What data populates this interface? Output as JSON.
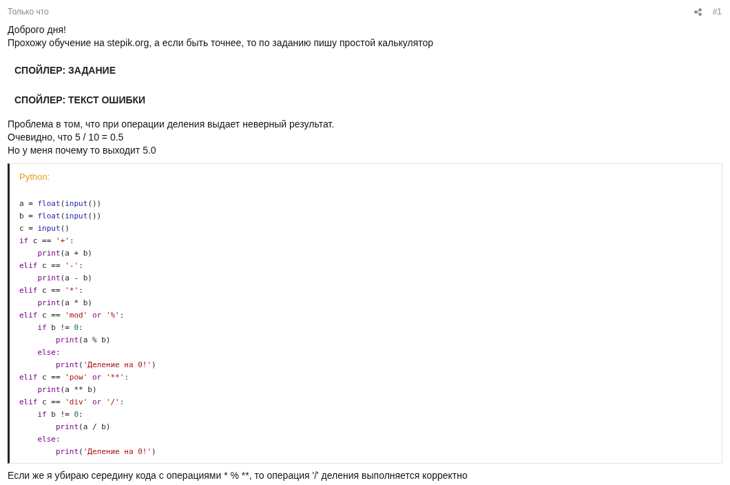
{
  "post": {
    "time": "Только что",
    "number": "#1"
  },
  "paragraphs_before": [
    "Доброго дня!",
    "Прохожу обучение на stepik.org, а если быть точнее, то по заданию пишу простой калькулятор"
  ],
  "spoilers": [
    "СПОЙЛЕР: ЗАДАНИЕ",
    "СПОЙЛЕР: ТЕКСТ ОШИБКИ"
  ],
  "paragraphs_middle": [
    "Проблема в том, что при операции деления выдает неверный результат.",
    "Очевидно, что 5 / 10 = 0.5",
    "Но у меня почему то выходит 5.0"
  ],
  "code_block": {
    "language": "Python:",
    "lines": [
      {
        "tokens": [
          {
            "kind": "plain",
            "text": "a = "
          },
          {
            "kind": "builtin",
            "text": "float"
          },
          {
            "kind": "plain",
            "text": "("
          },
          {
            "kind": "builtin",
            "text": "input"
          },
          {
            "kind": "plain",
            "text": "())"
          }
        ]
      },
      {
        "tokens": [
          {
            "kind": "plain",
            "text": "b = "
          },
          {
            "kind": "builtin",
            "text": "float"
          },
          {
            "kind": "plain",
            "text": "("
          },
          {
            "kind": "builtin",
            "text": "input"
          },
          {
            "kind": "plain",
            "text": "())"
          }
        ]
      },
      {
        "tokens": [
          {
            "kind": "plain",
            "text": "c = "
          },
          {
            "kind": "builtin",
            "text": "input"
          },
          {
            "kind": "plain",
            "text": "()"
          }
        ]
      },
      {
        "tokens": [
          {
            "kind": "keyword",
            "text": "if"
          },
          {
            "kind": "plain",
            "text": " c == "
          },
          {
            "kind": "string",
            "text": "'+'"
          },
          {
            "kind": "plain",
            "text": ":"
          }
        ],
        "children": [
          {
            "tokens": [
              {
                "kind": "keyword",
                "text": "print"
              },
              {
                "kind": "plain",
                "text": "(a + b)"
              }
            ]
          }
        ]
      },
      {
        "tokens": [
          {
            "kind": "keyword",
            "text": "elif"
          },
          {
            "kind": "plain",
            "text": " c == "
          },
          {
            "kind": "string",
            "text": "'-'"
          },
          {
            "kind": "plain",
            "text": ":"
          }
        ],
        "children": [
          {
            "tokens": [
              {
                "kind": "keyword",
                "text": "print"
              },
              {
                "kind": "plain",
                "text": "(a - b)"
              }
            ]
          }
        ]
      },
      {
        "tokens": [
          {
            "kind": "keyword",
            "text": "elif"
          },
          {
            "kind": "plain",
            "text": " c == "
          },
          {
            "kind": "string",
            "text": "'*'"
          },
          {
            "kind": "plain",
            "text": ":"
          }
        ],
        "children": [
          {
            "tokens": [
              {
                "kind": "keyword",
                "text": "print"
              },
              {
                "kind": "plain",
                "text": "(a * b)"
              }
            ]
          }
        ]
      },
      {
        "tokens": [
          {
            "kind": "keyword",
            "text": "elif"
          },
          {
            "kind": "plain",
            "text": " c == "
          },
          {
            "kind": "string",
            "text": "'mod'"
          },
          {
            "kind": "keyword",
            "text": " or "
          },
          {
            "kind": "string",
            "text": "'%'"
          },
          {
            "kind": "plain",
            "text": ":"
          }
        ],
        "children": [
          {
            "tokens": [
              {
                "kind": "keyword",
                "text": "if"
              },
              {
                "kind": "plain",
                "text": " b != "
              },
              {
                "kind": "number",
                "text": "0"
              },
              {
                "kind": "plain",
                "text": ":"
              }
            ],
            "children": [
              {
                "tokens": [
                  {
                    "kind": "keyword",
                    "text": "print"
                  },
                  {
                    "kind": "plain",
                    "text": "(a % b)"
                  }
                ]
              }
            ]
          },
          {
            "tokens": [
              {
                "kind": "keyword",
                "text": "else"
              },
              {
                "kind": "plain",
                "text": ":"
              }
            ],
            "children": [
              {
                "tokens": [
                  {
                    "kind": "keyword",
                    "text": "print"
                  },
                  {
                    "kind": "plain",
                    "text": "("
                  },
                  {
                    "kind": "string",
                    "text": "'Деление на 0!'"
                  },
                  {
                    "kind": "plain",
                    "text": ")"
                  }
                ]
              }
            ]
          }
        ]
      },
      {
        "tokens": [
          {
            "kind": "keyword",
            "text": "elif"
          },
          {
            "kind": "plain",
            "text": " c == "
          },
          {
            "kind": "string",
            "text": "'pow'"
          },
          {
            "kind": "keyword",
            "text": " or "
          },
          {
            "kind": "string",
            "text": "'**'"
          },
          {
            "kind": "plain",
            "text": ":"
          }
        ],
        "children": [
          {
            "tokens": [
              {
                "kind": "keyword",
                "text": "print"
              },
              {
                "kind": "plain",
                "text": "(a ** b)"
              }
            ]
          }
        ]
      },
      {
        "tokens": [
          {
            "kind": "keyword",
            "text": "elif"
          },
          {
            "kind": "plain",
            "text": " c == "
          },
          {
            "kind": "string",
            "text": "'div'"
          },
          {
            "kind": "keyword",
            "text": " or "
          },
          {
            "kind": "string",
            "text": "'/'"
          },
          {
            "kind": "plain",
            "text": ":"
          }
        ],
        "children": [
          {
            "tokens": [
              {
                "kind": "keyword",
                "text": "if"
              },
              {
                "kind": "plain",
                "text": " b != "
              },
              {
                "kind": "number",
                "text": "0"
              },
              {
                "kind": "plain",
                "text": ":"
              }
            ],
            "children": [
              {
                "tokens": [
                  {
                    "kind": "keyword",
                    "text": "print"
                  },
                  {
                    "kind": "plain",
                    "text": "(a / b)"
                  }
                ]
              }
            ]
          },
          {
            "tokens": [
              {
                "kind": "keyword",
                "text": "else"
              },
              {
                "kind": "plain",
                "text": ":"
              }
            ],
            "children": [
              {
                "tokens": [
                  {
                    "kind": "keyword",
                    "text": "print"
                  },
                  {
                    "kind": "plain",
                    "text": "("
                  },
                  {
                    "kind": "string",
                    "text": "'Деление на 0!'"
                  },
                  {
                    "kind": "plain",
                    "text": ")"
                  }
                ]
              }
            ]
          }
        ]
      }
    ]
  },
  "paragraphs_after": [
    "Если же я убираю середину кода с операциями * % **, то операция '/' деления выполняется корректно"
  ]
}
